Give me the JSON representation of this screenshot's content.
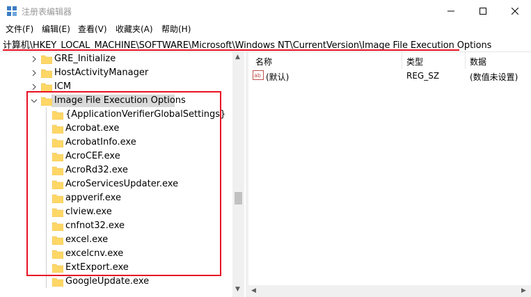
{
  "window": {
    "title": "注册表编辑器",
    "minimize_icon": "minimize-icon",
    "maximize_icon": "maximize-icon",
    "close_icon": "close-icon"
  },
  "menu": {
    "items": [
      "文件(F)",
      "编辑(E)",
      "查看(V)",
      "收藏夹(A)",
      "帮助(H)"
    ]
  },
  "address": {
    "path": "计算机\\HKEY_LOCAL_MACHINE\\SOFTWARE\\Microsoft\\Windows NT\\CurrentVersion\\Image File Execution Options"
  },
  "tree": {
    "items": [
      {
        "label": "GRE_Initialize",
        "expander": "chevron-right"
      },
      {
        "label": "HostActivityManager",
        "expander": "chevron-right"
      },
      {
        "label": "ICM",
        "expander": "chevron-right"
      },
      {
        "label": "Image File Execution Options",
        "expander": "chevron-down",
        "selected": true
      },
      {
        "label": "{ApplicationVerifierGlobalSettings}"
      },
      {
        "label": "Acrobat.exe"
      },
      {
        "label": "AcrobatInfo.exe"
      },
      {
        "label": "AcroCEF.exe"
      },
      {
        "label": "AcroRd32.exe"
      },
      {
        "label": "AcroServicesUpdater.exe"
      },
      {
        "label": "appverif.exe"
      },
      {
        "label": "clview.exe"
      },
      {
        "label": "cnfnot32.exe"
      },
      {
        "label": "excel.exe"
      },
      {
        "label": "excelcnv.exe"
      },
      {
        "label": "ExtExport.exe"
      },
      {
        "label": "GoogleUpdate.exe"
      }
    ]
  },
  "list": {
    "columns": [
      "名称",
      "类型",
      "数据"
    ],
    "rows": [
      {
        "name": "(默认)",
        "type": "REG_SZ",
        "data": "(数值未设置)",
        "icon": "string-value-icon"
      }
    ]
  },
  "colors": {
    "highlight_red": "#e81123",
    "selection_gray": "#d9d9d9",
    "folder_yellow": "#ffd766"
  }
}
